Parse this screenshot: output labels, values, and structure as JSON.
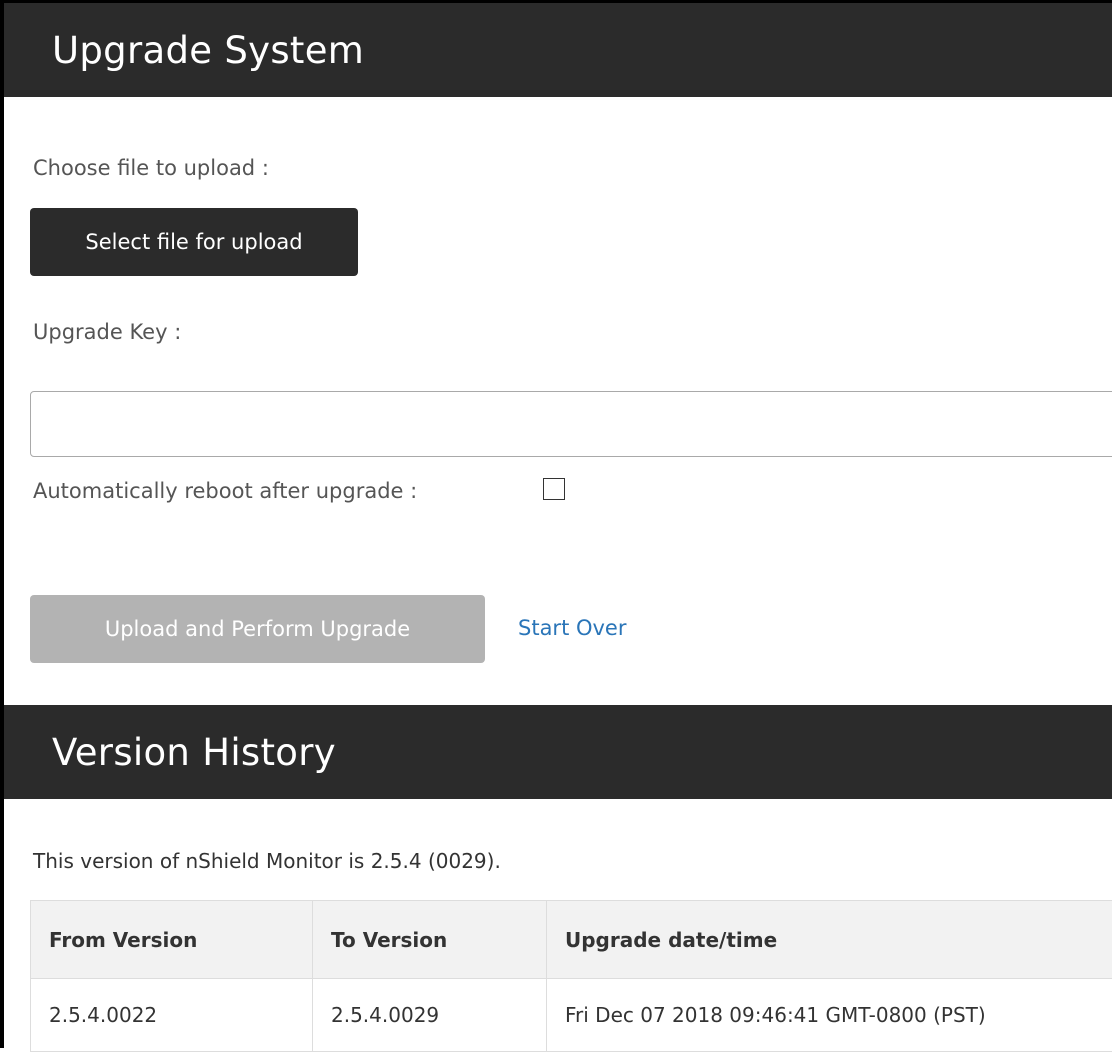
{
  "upgrade_section": {
    "title": "Upgrade System",
    "choose_file_label": "Choose file to upload :",
    "select_file_button": "Select file for upload",
    "upgrade_key_label": "Upgrade Key :",
    "upgrade_key_value": "",
    "auto_reboot_label": "Automatically reboot after upgrade :",
    "auto_reboot_checked": false,
    "upload_button": "Upload and Perform Upgrade",
    "upload_button_disabled": true,
    "start_over_link": "Start Over"
  },
  "version_section": {
    "title": "Version History",
    "current_version_text": "This version of nShield Monitor is 2.5.4 (0029).",
    "table": {
      "headers": [
        "From Version",
        "To Version",
        "Upgrade date/time"
      ],
      "rows": [
        [
          "2.5.4.0022",
          "2.5.4.0029",
          "Fri Dec 07 2018 09:46:41 GMT-0800 (PST)"
        ]
      ]
    }
  },
  "colors": {
    "header_bg": "#2b2b2b",
    "button_dark": "#2b2b2b",
    "button_disabled": "#b3b3b3",
    "link": "#2a75b8"
  }
}
